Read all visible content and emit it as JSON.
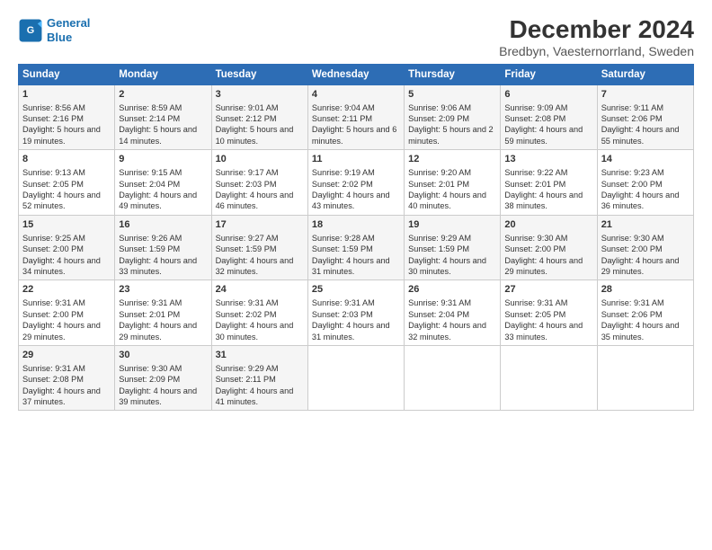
{
  "logo": {
    "line1": "General",
    "line2": "Blue"
  },
  "title": "December 2024",
  "subtitle": "Bredbyn, Vaesternorrland, Sweden",
  "columns": [
    "Sunday",
    "Monday",
    "Tuesday",
    "Wednesday",
    "Thursday",
    "Friday",
    "Saturday"
  ],
  "weeks": [
    [
      {
        "day": "1",
        "sunrise": "Sunrise: 8:56 AM",
        "sunset": "Sunset: 2:16 PM",
        "daylight": "Daylight: 5 hours and 19 minutes."
      },
      {
        "day": "2",
        "sunrise": "Sunrise: 8:59 AM",
        "sunset": "Sunset: 2:14 PM",
        "daylight": "Daylight: 5 hours and 14 minutes."
      },
      {
        "day": "3",
        "sunrise": "Sunrise: 9:01 AM",
        "sunset": "Sunset: 2:12 PM",
        "daylight": "Daylight: 5 hours and 10 minutes."
      },
      {
        "day": "4",
        "sunrise": "Sunrise: 9:04 AM",
        "sunset": "Sunset: 2:11 PM",
        "daylight": "Daylight: 5 hours and 6 minutes."
      },
      {
        "day": "5",
        "sunrise": "Sunrise: 9:06 AM",
        "sunset": "Sunset: 2:09 PM",
        "daylight": "Daylight: 5 hours and 2 minutes."
      },
      {
        "day": "6",
        "sunrise": "Sunrise: 9:09 AM",
        "sunset": "Sunset: 2:08 PM",
        "daylight": "Daylight: 4 hours and 59 minutes."
      },
      {
        "day": "7",
        "sunrise": "Sunrise: 9:11 AM",
        "sunset": "Sunset: 2:06 PM",
        "daylight": "Daylight: 4 hours and 55 minutes."
      }
    ],
    [
      {
        "day": "8",
        "sunrise": "Sunrise: 9:13 AM",
        "sunset": "Sunset: 2:05 PM",
        "daylight": "Daylight: 4 hours and 52 minutes."
      },
      {
        "day": "9",
        "sunrise": "Sunrise: 9:15 AM",
        "sunset": "Sunset: 2:04 PM",
        "daylight": "Daylight: 4 hours and 49 minutes."
      },
      {
        "day": "10",
        "sunrise": "Sunrise: 9:17 AM",
        "sunset": "Sunset: 2:03 PM",
        "daylight": "Daylight: 4 hours and 46 minutes."
      },
      {
        "day": "11",
        "sunrise": "Sunrise: 9:19 AM",
        "sunset": "Sunset: 2:02 PM",
        "daylight": "Daylight: 4 hours and 43 minutes."
      },
      {
        "day": "12",
        "sunrise": "Sunrise: 9:20 AM",
        "sunset": "Sunset: 2:01 PM",
        "daylight": "Daylight: 4 hours and 40 minutes."
      },
      {
        "day": "13",
        "sunrise": "Sunrise: 9:22 AM",
        "sunset": "Sunset: 2:01 PM",
        "daylight": "Daylight: 4 hours and 38 minutes."
      },
      {
        "day": "14",
        "sunrise": "Sunrise: 9:23 AM",
        "sunset": "Sunset: 2:00 PM",
        "daylight": "Daylight: 4 hours and 36 minutes."
      }
    ],
    [
      {
        "day": "15",
        "sunrise": "Sunrise: 9:25 AM",
        "sunset": "Sunset: 2:00 PM",
        "daylight": "Daylight: 4 hours and 34 minutes."
      },
      {
        "day": "16",
        "sunrise": "Sunrise: 9:26 AM",
        "sunset": "Sunset: 1:59 PM",
        "daylight": "Daylight: 4 hours and 33 minutes."
      },
      {
        "day": "17",
        "sunrise": "Sunrise: 9:27 AM",
        "sunset": "Sunset: 1:59 PM",
        "daylight": "Daylight: 4 hours and 32 minutes."
      },
      {
        "day": "18",
        "sunrise": "Sunrise: 9:28 AM",
        "sunset": "Sunset: 1:59 PM",
        "daylight": "Daylight: 4 hours and 31 minutes."
      },
      {
        "day": "19",
        "sunrise": "Sunrise: 9:29 AM",
        "sunset": "Sunset: 1:59 PM",
        "daylight": "Daylight: 4 hours and 30 minutes."
      },
      {
        "day": "20",
        "sunrise": "Sunrise: 9:30 AM",
        "sunset": "Sunset: 2:00 PM",
        "daylight": "Daylight: 4 hours and 29 minutes."
      },
      {
        "day": "21",
        "sunrise": "Sunrise: 9:30 AM",
        "sunset": "Sunset: 2:00 PM",
        "daylight": "Daylight: 4 hours and 29 minutes."
      }
    ],
    [
      {
        "day": "22",
        "sunrise": "Sunrise: 9:31 AM",
        "sunset": "Sunset: 2:00 PM",
        "daylight": "Daylight: 4 hours and 29 minutes."
      },
      {
        "day": "23",
        "sunrise": "Sunrise: 9:31 AM",
        "sunset": "Sunset: 2:01 PM",
        "daylight": "Daylight: 4 hours and 29 minutes."
      },
      {
        "day": "24",
        "sunrise": "Sunrise: 9:31 AM",
        "sunset": "Sunset: 2:02 PM",
        "daylight": "Daylight: 4 hours and 30 minutes."
      },
      {
        "day": "25",
        "sunrise": "Sunrise: 9:31 AM",
        "sunset": "Sunset: 2:03 PM",
        "daylight": "Daylight: 4 hours and 31 minutes."
      },
      {
        "day": "26",
        "sunrise": "Sunrise: 9:31 AM",
        "sunset": "Sunset: 2:04 PM",
        "daylight": "Daylight: 4 hours and 32 minutes."
      },
      {
        "day": "27",
        "sunrise": "Sunrise: 9:31 AM",
        "sunset": "Sunset: 2:05 PM",
        "daylight": "Daylight: 4 hours and 33 minutes."
      },
      {
        "day": "28",
        "sunrise": "Sunrise: 9:31 AM",
        "sunset": "Sunset: 2:06 PM",
        "daylight": "Daylight: 4 hours and 35 minutes."
      }
    ],
    [
      {
        "day": "29",
        "sunrise": "Sunrise: 9:31 AM",
        "sunset": "Sunset: 2:08 PM",
        "daylight": "Daylight: 4 hours and 37 minutes."
      },
      {
        "day": "30",
        "sunrise": "Sunrise: 9:30 AM",
        "sunset": "Sunset: 2:09 PM",
        "daylight": "Daylight: 4 hours and 39 minutes."
      },
      {
        "day": "31",
        "sunrise": "Sunrise: 9:29 AM",
        "sunset": "Sunset: 2:11 PM",
        "daylight": "Daylight: 4 hours and 41 minutes."
      },
      null,
      null,
      null,
      null
    ]
  ]
}
